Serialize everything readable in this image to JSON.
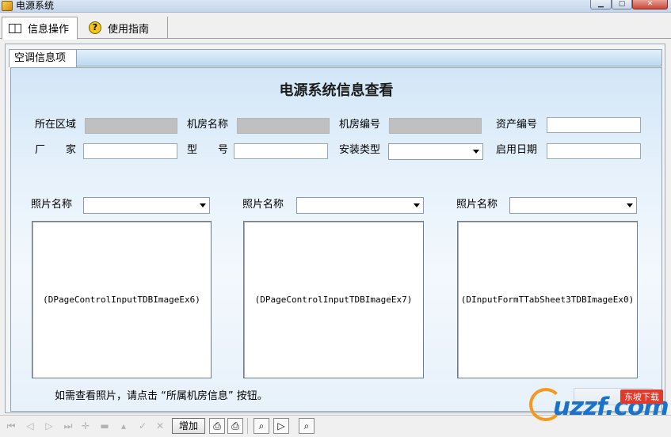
{
  "window": {
    "title": "电源系统",
    "buttons": {
      "minimize_icon": "minimize-icon",
      "maximize_icon": "maximize-icon",
      "close_icon": "close-icon"
    }
  },
  "top_tabs": [
    {
      "label": "信息操作",
      "icon": "book-icon",
      "active": true
    },
    {
      "label": "使用指南",
      "icon": "help-icon",
      "active": false
    }
  ],
  "inner_tab": {
    "label": "空调信息项"
  },
  "form": {
    "title": "电源系统信息查看",
    "row1": [
      {
        "label": "所在区域",
        "value": ""
      },
      {
        "label": "机房名称",
        "value": ""
      },
      {
        "label": "机房编号",
        "value": ""
      },
      {
        "label": "资产编号",
        "value": ""
      }
    ],
    "row2": [
      {
        "label": "厂家",
        "value": ""
      },
      {
        "label": "型号",
        "value": ""
      },
      {
        "label": "安装类型",
        "value": ""
      },
      {
        "label": "启用日期",
        "value": ""
      }
    ]
  },
  "photos": [
    {
      "label": "照片名称",
      "value": "",
      "image_placeholder": "(DPageControlInputTDBImageEx6)"
    },
    {
      "label": "照片名称",
      "value": "",
      "image_placeholder": "(DPageControlInputTDBImageEx7)"
    },
    {
      "label": "照片名称",
      "value": "",
      "image_placeholder": "(DInputFormTTabSheet3TDBImageEx0)"
    }
  ],
  "hint": "如需查看照片，请点击 “所属机房信息” 按钮。",
  "navigator": {
    "icons": [
      "first-record-icon",
      "prior-record-icon",
      "next-record-icon",
      "last-record-icon",
      "insert-record-icon",
      "delete-record-icon",
      "edit-record-icon",
      "post-record-icon",
      "cancel-record-icon"
    ],
    "add_label": "增加",
    "tools": [
      "print-icon",
      "print-export-icon",
      "preview-icon",
      "play-icon",
      "search-icon"
    ]
  },
  "watermark": {
    "text": "uzzf.com",
    "badge": "东坡下载"
  },
  "colors": {
    "accent": "#1a73c8",
    "panel_top": "#d2e6f7",
    "field_disabled": "#c0c0c0"
  }
}
